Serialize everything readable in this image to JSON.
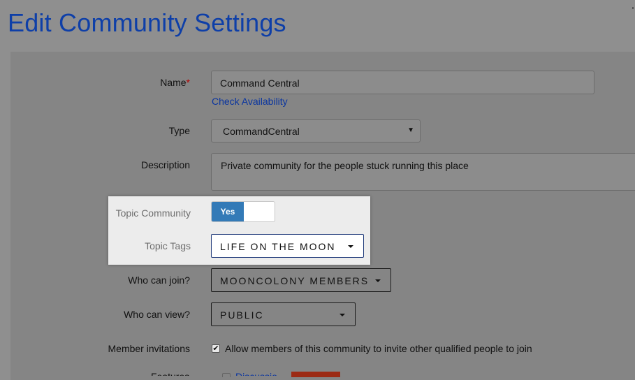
{
  "page": {
    "title": "Edit Community Settings"
  },
  "form": {
    "name": {
      "label": "Name",
      "required_mark": "*",
      "value": "Command Central",
      "check_link": "Check Availability"
    },
    "type": {
      "label": "Type",
      "value": "CommandCentral"
    },
    "description": {
      "label": "Description",
      "value": "Private community for the people stuck running this place"
    },
    "topic_community": {
      "label": "Topic Community",
      "toggle_on_label": "Yes",
      "enabled": true
    },
    "topic_tags": {
      "label": "Topic Tags",
      "value": "LIFE ON THE MOON"
    },
    "who_can_join": {
      "label": "Who can join?",
      "value": "MOONCOLONY MEMBERS"
    },
    "who_can_view": {
      "label": "Who can view?",
      "value": "PUBLIC"
    },
    "member_invitations": {
      "label": "Member invitations",
      "checked": true,
      "checkbox_label": "Allow members of this community to invite other qualified people to join"
    },
    "features_partial": {
      "label": "Features",
      "link": "Discussion"
    }
  },
  "colors": {
    "title": "#0e3fa8",
    "link": "#0a35a0",
    "toggle_on": "#337ab7",
    "required": "#b30000"
  }
}
